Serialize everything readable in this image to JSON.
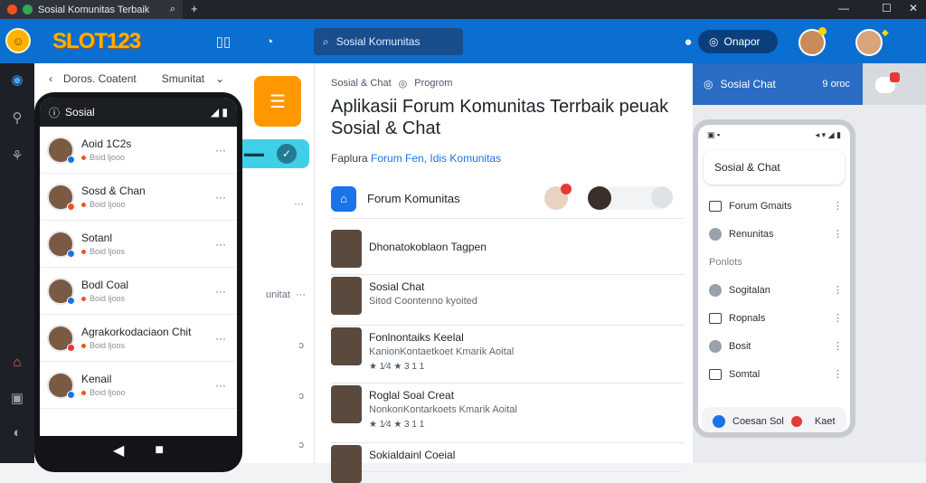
{
  "browser": {
    "tab_title": "Sosial Komunitas Terbaik",
    "add_tab": "+",
    "window_controls": [
      "—",
      "☐",
      "✕"
    ]
  },
  "header": {
    "logo_text": "SLOT123",
    "search_placeholder": "Sosial Komunitas",
    "action_button": "Onapor"
  },
  "left_panel": {
    "back_label": "Doros. Coatent",
    "dropdown_label": "Smunitat",
    "phone_status_label": "Sosial",
    "side_labels": [
      "unitat"
    ],
    "chats": [
      {
        "name": "Aoid 1C2s",
        "sub": "Bsid ljooo",
        "badge": "#1a73e8"
      },
      {
        "name": "Sosd & Chan",
        "sub": "Boid ljooo",
        "badge": "#f4511e"
      },
      {
        "name": "Sotanl",
        "sub": "Boid ljoos",
        "badge": "#1a73e8"
      },
      {
        "name": "Bodl Coal",
        "sub": "Boid ljoos",
        "badge": "#1a73e8"
      },
      {
        "name": "Agrakorkodaciaon Chit",
        "sub": "Boid ljoos",
        "badge": "#e53935"
      },
      {
        "name": "Kenail",
        "sub": "Boid ljooo",
        "badge": "#1a73e8"
      }
    ]
  },
  "main": {
    "breadcrumb": [
      "Sosial & Chat",
      "Progrom"
    ],
    "title": "Aplikasii Forum Komunitas Terrbaik peuak Sosial & Chat",
    "subline_prefix": "Faplura",
    "subline_links": "Forum Fen, Idis Komunitas",
    "forum_card_label": "Forum Komunitas",
    "feed": [
      {
        "title": "Dhonatokoblaon Tagpen",
        "sub": "",
        "stars": ""
      },
      {
        "title": "Sosial Chat",
        "sub": "Sitod Coontenno kyoited",
        "stars": ""
      },
      {
        "title": "Fonlnontaiks Keelal",
        "sub": "KanionKontaetkoet Kmarik Aoital",
        "stars": "★ 1⁄4  ★ 3 1 1"
      },
      {
        "title": "Roglal Soal Creat",
        "sub": "NonkonKontarkoets Kmarik Aoital",
        "stars": "★ 1⁄4  ★ 3 1 1"
      },
      {
        "title": "Sokialdainl Coeial",
        "sub": "",
        "stars": ""
      }
    ]
  },
  "right_panel": {
    "header_label": "Sosial Chat",
    "header_meta": "9 oroc",
    "phone_card": "Sosial & Chat",
    "rows": [
      {
        "label": "Forum Gmaits",
        "kind": "square"
      },
      {
        "label": "Renunitas",
        "kind": "circle"
      },
      {
        "label": "Ponlots",
        "kind": "section"
      },
      {
        "label": "Sogitalan",
        "kind": "circle"
      },
      {
        "label": "Ropnals",
        "kind": "square"
      },
      {
        "label": "Bosit",
        "kind": "circle"
      },
      {
        "label": "Somtal",
        "kind": "square"
      }
    ],
    "footer_left": "Coesan Sol",
    "footer_right": "Kaet"
  },
  "colors": {
    "appbar": "#0b6ed1",
    "accent_orange": "#ff9800",
    "accent_cyan": "#3fd0e8",
    "notify_red": "#e53935"
  }
}
